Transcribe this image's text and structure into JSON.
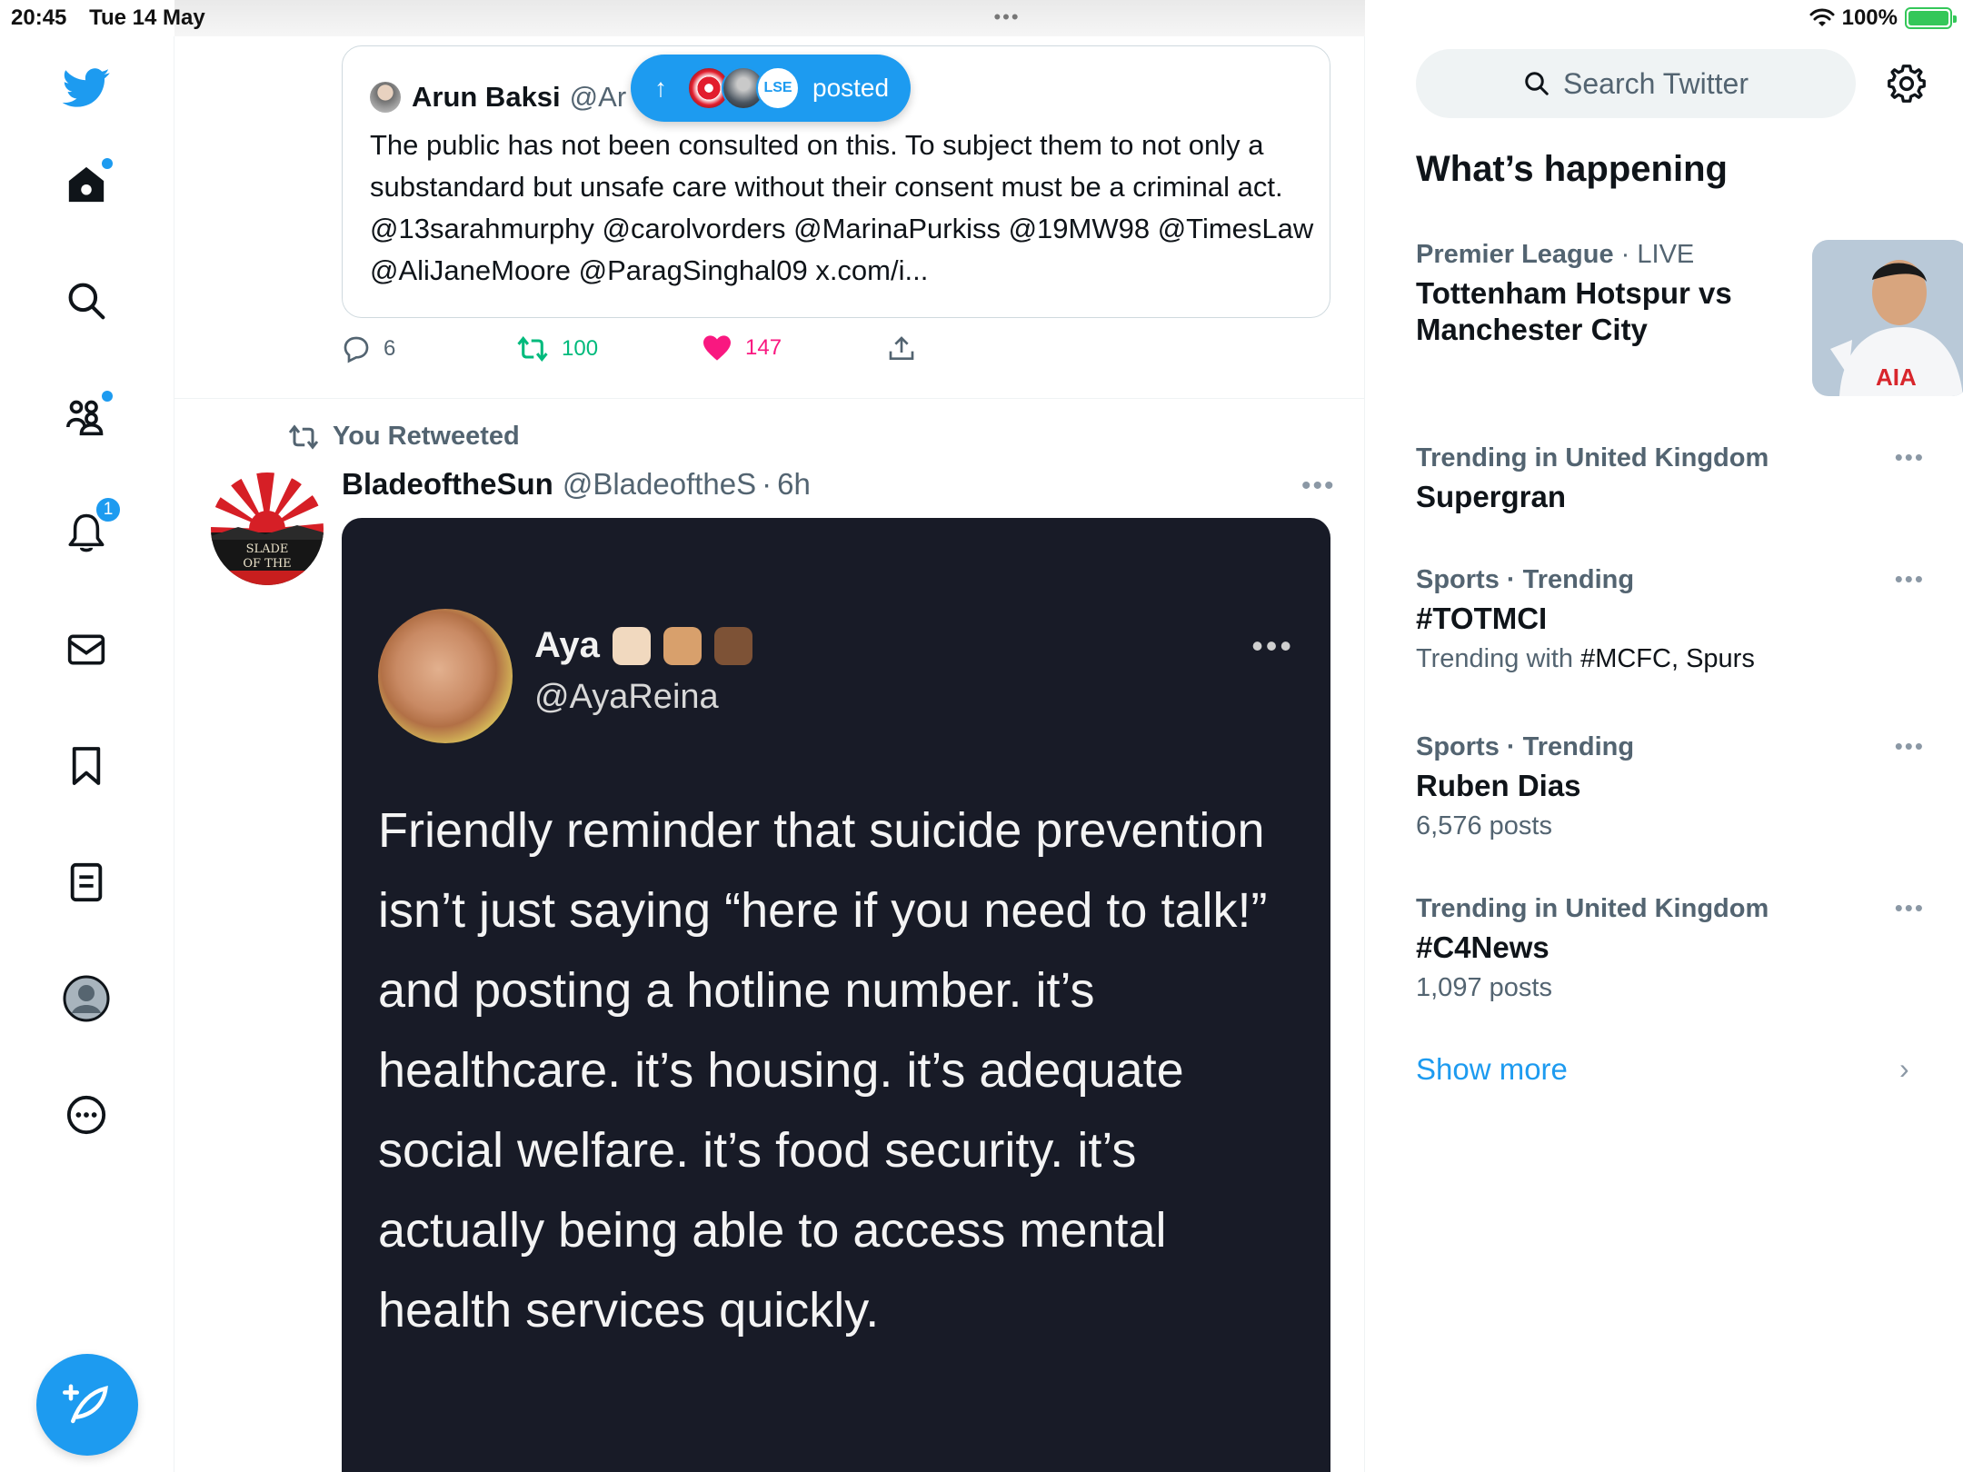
{
  "status_bar": {
    "time": "20:45",
    "date": "Tue 14 May",
    "battery": "100%",
    "battery_level": 1.0,
    "handle_dots": "•••"
  },
  "nav": {
    "items": [
      {
        "name": "twitter-logo",
        "icon": "twitter-bird-icon"
      },
      {
        "name": "home",
        "icon": "home-icon",
        "dot": true
      },
      {
        "name": "explore",
        "icon": "search-icon"
      },
      {
        "name": "communities",
        "icon": "communities-icon",
        "dot": true
      },
      {
        "name": "notifications",
        "icon": "bell-icon",
        "badge": "1"
      },
      {
        "name": "messages",
        "icon": "envelope-icon"
      },
      {
        "name": "bookmarks",
        "icon": "bookmark-icon"
      },
      {
        "name": "lists",
        "icon": "list-icon"
      },
      {
        "name": "profile",
        "icon": "profile-icon"
      },
      {
        "name": "more",
        "icon": "more-circle-icon"
      }
    ],
    "notification_badge": "1",
    "compose_icon": "compose-feather-icon"
  },
  "quote_tweet": {
    "author_name": "Arun Baksi",
    "author_handle": "@Ar",
    "text": "The public has not been consulted on this. To subject them to not only a substandard but unsafe care without their consent must be a criminal act. @13sarahmurphy @carolvorders @MarinaPurkiss @19MW98 @TimesLaw @AliJaneMoore @ParagSinghal09 x.com/i..."
  },
  "posted_pill": {
    "label": "posted",
    "arrow": "↑"
  },
  "actions": {
    "reply_count": "6",
    "retweet_count": "100",
    "like_count": "147"
  },
  "retweet": {
    "label": "You Retweeted",
    "author_name": "BladeoftheSun",
    "author_handle": "@BladeoftheS",
    "separator": "·",
    "time": "6h",
    "more": "•••",
    "avatar_text": "SLADE\nOF THE",
    "media": {
      "name": "Aya",
      "handle": "@AyaReina",
      "text": "Friendly reminder that suicide prevention isn’t just saying “here if you need to talk!” and posting a hotline number. it’s healthcare. it’s housing. it’s adequate social welfare. it’s food security. it’s actually being able to access mental health services quickly.",
      "dots": "•••"
    }
  },
  "sidebar": {
    "search_placeholder": "Search Twitter",
    "whats_happening": "What’s happening",
    "trends": [
      {
        "category": "Premier League",
        "status": "· LIVE",
        "title": "Tottenham Hotspur vs Manchester City",
        "has_image": true
      },
      {
        "category": "Trending in United Kingdom",
        "title": "Supergran"
      },
      {
        "category": "Sports · Trending",
        "title": "#TOTMCI",
        "sub_prefix": "Trending with ",
        "sub_dark": "#MCFC, Spurs"
      },
      {
        "category": "Sports · Trending",
        "title": "Ruben Dias",
        "sub": "6,576 posts"
      },
      {
        "category": "Trending in United Kingdom",
        "title": "#C4News",
        "sub": "1,097 posts"
      }
    ],
    "trend_dots": "•••",
    "show_more": "Show more",
    "show_more_chevron": "›"
  },
  "colors": {
    "accent": "#1d9bf0",
    "retweet_green": "#00ba7c",
    "like_pink": "#f91880",
    "secondary_text": "#536471"
  }
}
